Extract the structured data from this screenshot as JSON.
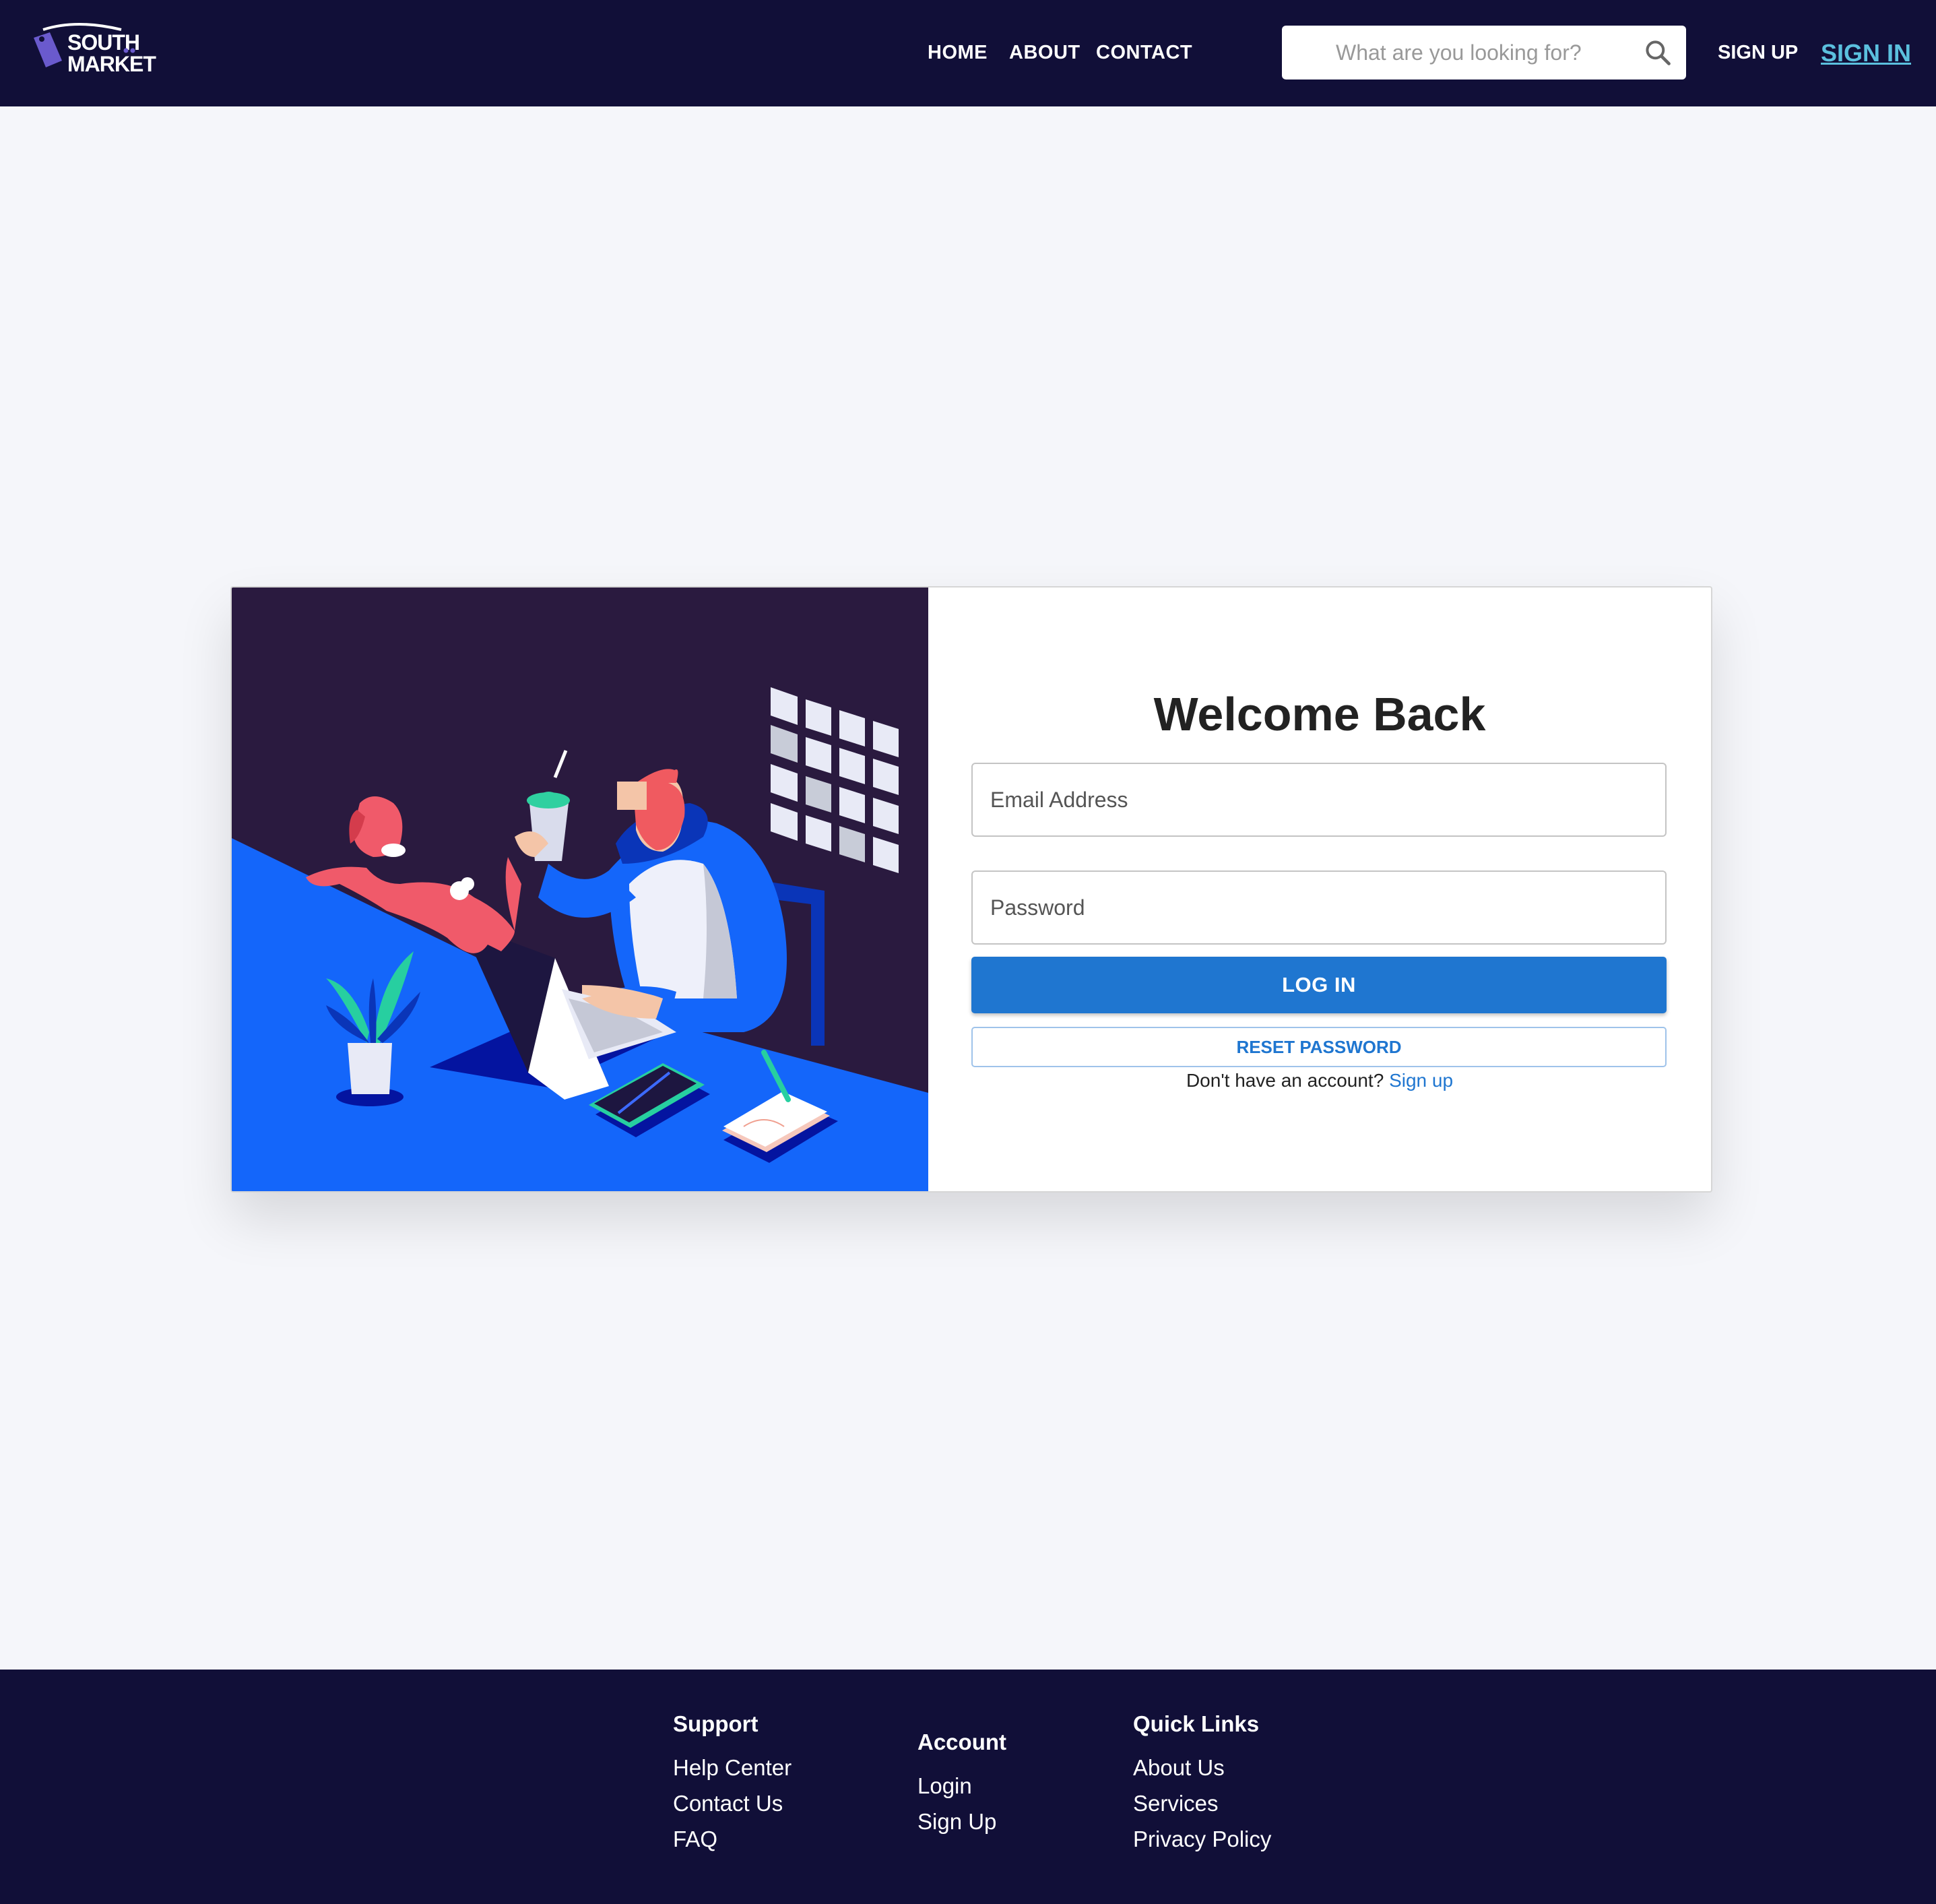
{
  "header": {
    "logo_alt": "South Market",
    "logo_text_top": "SOUTH",
    "logo_text_bottom": "MARKET",
    "nav": [
      "HOME",
      "ABOUT",
      "CONTACT"
    ],
    "search_placeholder": "What are you looking for?",
    "search_icon": "search-icon",
    "signup_label": "SIGN UP",
    "signin_label": "SIGN IN"
  },
  "login": {
    "title": "Welcome Back",
    "email_placeholder": "Email Address",
    "password_placeholder": "Password",
    "login_button": "LOG IN",
    "reset_button": "RESET PASSWORD",
    "signup_prompt": "Don't have an account?",
    "signup_link": "Sign up"
  },
  "footer": {
    "columns": [
      {
        "heading": "Support",
        "links": [
          "Help Center",
          "Contact Us",
          "FAQ"
        ]
      },
      {
        "heading": "Account",
        "links": [
          "Login",
          "Sign Up"
        ]
      },
      {
        "heading": "Quick Links",
        "links": [
          "About Us",
          "Services",
          "Privacy Policy"
        ]
      }
    ]
  },
  "colors": {
    "header_bg": "#110f38",
    "accent": "#1f76d0",
    "signin_link": "#5bc0de",
    "illustration_bg": "#2a1a3f",
    "illustration_floor": "#1466fa",
    "page_bg": "#f5f6fa"
  }
}
